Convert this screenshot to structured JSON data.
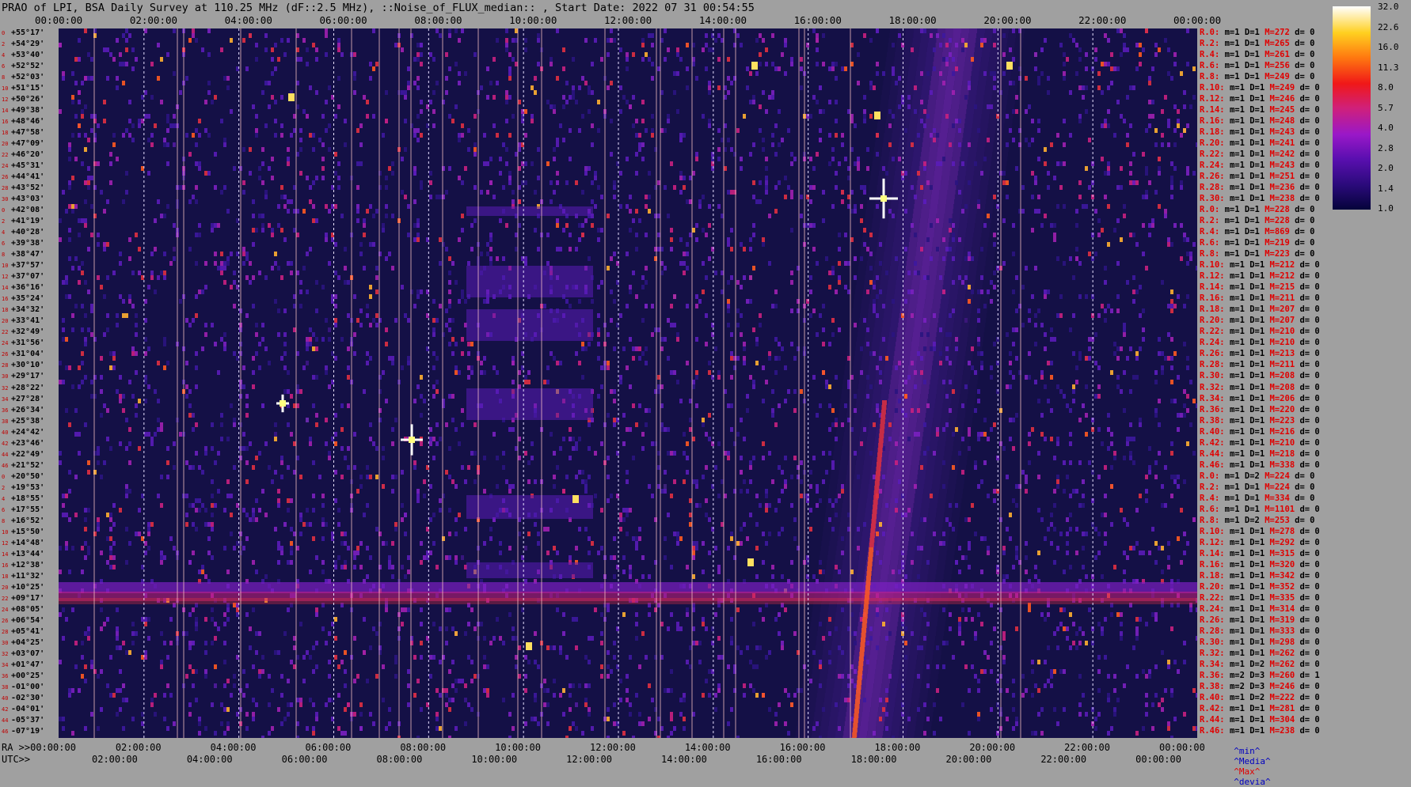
{
  "header": {
    "title": "PRAO of LPI, BSA Daily Survey at 110.25 MHz (dF::2.5 MHz), ::Noise_of_FLUX_median:: , Start Date: 2022 07 31 00:54:55"
  },
  "chart_data": {
    "type": "heatmap",
    "title": "PRAO of LPI, BSA Daily Survey at 110.25 MHz (dF::2.5 MHz), ::Noise_of_FLUX_median:: , Start Date: 2022 07 31 00:54:55",
    "top_axis_ticks": [
      "00:00:00",
      "02:00:00",
      "04:00:00",
      "06:00:00",
      "08:00:00",
      "10:00:00",
      "12:00:00",
      "14:00:00",
      "16:00:00",
      "18:00:00",
      "20:00:00",
      "22:00:00",
      "00:00:00"
    ],
    "bottom_ra_label": "RA >>00:00:00",
    "bottom_ra_ticks": [
      "02:00:00",
      "04:00:00",
      "06:00:00",
      "08:00:00",
      "10:00:00",
      "12:00:00",
      "14:00:00",
      "16:00:00",
      "18:00:00",
      "20:00:00",
      "22:00:00",
      "00:00:00"
    ],
    "bottom_utc_label": "UTC>>",
    "bottom_utc_ticks": [
      "02:00:00",
      "04:00:00",
      "06:00:00",
      "08:00:00",
      "10:00:00",
      "12:00:00",
      "14:00:00",
      "16:00:00",
      "18:00:00",
      "20:00:00",
      "22:00:00",
      "00:00:00"
    ],
    "declinations": [
      "+55°17'",
      "+54°29'",
      "+53°40'",
      "+52°52'",
      "+52°03'",
      "+51°15'",
      "+50°26'",
      "+49°38'",
      "+48°46'",
      "+47°58'",
      "+47°09'",
      "+46°20'",
      "+45°31'",
      "+44°41'",
      "+43°52'",
      "+43°03'",
      "+42°08'",
      "+41°19'",
      "+40°28'",
      "+39°38'",
      "+38°47'",
      "+37°57'",
      "+37°07'",
      "+36°16'",
      "+35°24'",
      "+34°32'",
      "+33°41'",
      "+32°49'",
      "+31°56'",
      "+31°04'",
      "+30°10'",
      "+29°17'",
      "+28°22'",
      "+27°28'",
      "+26°34'",
      "+25°38'",
      "+24°42'",
      "+23°46'",
      "+22°49'",
      "+21°52'",
      "+20°50'",
      "+19°53'",
      "+18°55'",
      "+17°55'",
      "+16°52'",
      "+15°50'",
      "+14°48'",
      "+13°44'",
      "+12°38'",
      "+11°32'",
      "+10°25'",
      "+09°17'",
      "+08°05'",
      "+06°54'",
      "+05°41'",
      "+04°25'",
      "+03°07'",
      "+01°47'",
      "+00°25'",
      "-01°00'",
      "-02°30'",
      "-04°01'",
      "-05°37'",
      "-07°19'"
    ],
    "beam_indices": [
      "0",
      "2",
      "4",
      "6",
      "8",
      "10",
      "12",
      "14",
      "16",
      "18",
      "20",
      "22",
      "24",
      "26",
      "28",
      "30",
      "0",
      "2",
      "4",
      "6",
      "8",
      "10",
      "12",
      "14",
      "16",
      "18",
      "20",
      "22",
      "24",
      "26",
      "28",
      "30",
      "32",
      "34",
      "36",
      "38",
      "40",
      "42",
      "44",
      "46",
      "0",
      "2",
      "4",
      "6",
      "8",
      "10",
      "12",
      "14",
      "16",
      "18",
      "20",
      "22",
      "24",
      "26",
      "28",
      "30",
      "32",
      "34",
      "36",
      "38",
      "40",
      "42",
      "44",
      "46"
    ],
    "colorbar": {
      "ticks": [
        "32.0",
        "22.6",
        "16.0",
        "11.3",
        "8.0",
        "5.7",
        "4.0",
        "2.8",
        "2.0",
        "1.4",
        "1.0"
      ],
      "scale": "log"
    },
    "right_stats": [
      {
        "r": "R.0:",
        "m": "m=1",
        "d": "D=1",
        "M": "M=272",
        "dv": "d= 0"
      },
      {
        "r": "R.2:",
        "m": "m=1",
        "d": "D=1",
        "M": "M=265",
        "dv": "d= 0"
      },
      {
        "r": "R.4:",
        "m": "m=1",
        "d": "D=1",
        "M": "M=261",
        "dv": "d= 0"
      },
      {
        "r": "R.6:",
        "m": "m=1",
        "d": "D=1",
        "M": "M=256",
        "dv": "d= 0"
      },
      {
        "r": "R.8:",
        "m": "m=1",
        "d": "D=1",
        "M": "M=249",
        "dv": "d= 0"
      },
      {
        "r": "R.10:",
        "m": "m=1",
        "d": "D=1",
        "M": "M=249",
        "dv": "d= 0"
      },
      {
        "r": "R.12:",
        "m": "m=1",
        "d": "D=1",
        "M": "M=246",
        "dv": "d= 0"
      },
      {
        "r": "R.14:",
        "m": "m=1",
        "d": "D=1",
        "M": "M=245",
        "dv": "d= 0"
      },
      {
        "r": "R.16:",
        "m": "m=1",
        "d": "D=1",
        "M": "M=248",
        "dv": "d= 0"
      },
      {
        "r": "R.18:",
        "m": "m=1",
        "d": "D=1",
        "M": "M=243",
        "dv": "d= 0"
      },
      {
        "r": "R.20:",
        "m": "m=1",
        "d": "D=1",
        "M": "M=241",
        "dv": "d= 0"
      },
      {
        "r": "R.22:",
        "m": "m=1",
        "d": "D=1",
        "M": "M=242",
        "dv": "d= 0"
      },
      {
        "r": "R.24:",
        "m": "m=1",
        "d": "D=1",
        "M": "M=243",
        "dv": "d= 0"
      },
      {
        "r": "R.26:",
        "m": "m=1",
        "d": "D=1",
        "M": "M=251",
        "dv": "d= 0"
      },
      {
        "r": "R.28:",
        "m": "m=1",
        "d": "D=1",
        "M": "M=236",
        "dv": "d= 0"
      },
      {
        "r": "R.30:",
        "m": "m=1",
        "d": "D=1",
        "M": "M=238",
        "dv": "d= 0"
      },
      {
        "r": "R.0:",
        "m": "m=1",
        "d": "D=1",
        "M": "M=228",
        "dv": "d= 0"
      },
      {
        "r": "R.2:",
        "m": "m=1",
        "d": "D=1",
        "M": "M=228",
        "dv": "d= 0"
      },
      {
        "r": "R.4:",
        "m": "m=1",
        "d": "D=1",
        "M": "M=869",
        "dv": "d= 0"
      },
      {
        "r": "R.6:",
        "m": "m=1",
        "d": "D=1",
        "M": "M=219",
        "dv": "d= 0"
      },
      {
        "r": "R.8:",
        "m": "m=1",
        "d": "D=1",
        "M": "M=223",
        "dv": "d= 0"
      },
      {
        "r": "R.10:",
        "m": "m=1",
        "d": "D=1",
        "M": "M=212",
        "dv": "d= 0"
      },
      {
        "r": "R.12:",
        "m": "m=1",
        "d": "D=1",
        "M": "M=212",
        "dv": "d= 0"
      },
      {
        "r": "R.14:",
        "m": "m=1",
        "d": "D=1",
        "M": "M=215",
        "dv": "d= 0"
      },
      {
        "r": "R.16:",
        "m": "m=1",
        "d": "D=1",
        "M": "M=211",
        "dv": "d= 0"
      },
      {
        "r": "R.18:",
        "m": "m=1",
        "d": "D=1",
        "M": "M=207",
        "dv": "d= 0"
      },
      {
        "r": "R.20:",
        "m": "m=1",
        "d": "D=1",
        "M": "M=207",
        "dv": "d= 0"
      },
      {
        "r": "R.22:",
        "m": "m=1",
        "d": "D=1",
        "M": "M=210",
        "dv": "d= 0"
      },
      {
        "r": "R.24:",
        "m": "m=1",
        "d": "D=1",
        "M": "M=210",
        "dv": "d= 0"
      },
      {
        "r": "R.26:",
        "m": "m=1",
        "d": "D=1",
        "M": "M=213",
        "dv": "d= 0"
      },
      {
        "r": "R.28:",
        "m": "m=1",
        "d": "D=1",
        "M": "M=211",
        "dv": "d= 0"
      },
      {
        "r": "R.30:",
        "m": "m=1",
        "d": "D=1",
        "M": "M=208",
        "dv": "d= 0"
      },
      {
        "r": "R.32:",
        "m": "m=1",
        "d": "D=1",
        "M": "M=208",
        "dv": "d= 0"
      },
      {
        "r": "R.34:",
        "m": "m=1",
        "d": "D=1",
        "M": "M=206",
        "dv": "d= 0"
      },
      {
        "r": "R.36:",
        "m": "m=1",
        "d": "D=1",
        "M": "M=220",
        "dv": "d= 0"
      },
      {
        "r": "R.38:",
        "m": "m=1",
        "d": "D=1",
        "M": "M=223",
        "dv": "d= 0"
      },
      {
        "r": "R.40:",
        "m": "m=1",
        "d": "D=1",
        "M": "M=216",
        "dv": "d= 0"
      },
      {
        "r": "R.42:",
        "m": "m=1",
        "d": "D=1",
        "M": "M=210",
        "dv": "d= 0"
      },
      {
        "r": "R.44:",
        "m": "m=1",
        "d": "D=1",
        "M": "M=218",
        "dv": "d= 0"
      },
      {
        "r": "R.46:",
        "m": "m=1",
        "d": "D=1",
        "M": "M=338",
        "dv": "d= 0"
      },
      {
        "r": "R.0:",
        "m": "m=1",
        "d": "D=2",
        "M": "M=224",
        "dv": "d= 0"
      },
      {
        "r": "R.2:",
        "m": "m=1",
        "d": "D=1",
        "M": "M=224",
        "dv": "d= 0"
      },
      {
        "r": "R.4:",
        "m": "m=1",
        "d": "D=1",
        "M": "M=334",
        "dv": "d= 0"
      },
      {
        "r": "R.6:",
        "m": "m=1",
        "d": "D=1",
        "M": "M=1101",
        "dv": "d= 0"
      },
      {
        "r": "R.8:",
        "m": "m=1",
        "d": "D=2",
        "M": "M=253",
        "dv": "d= 0"
      },
      {
        "r": "R.10:",
        "m": "m=1",
        "d": "D=1",
        "M": "M=278",
        "dv": "d= 0"
      },
      {
        "r": "R.12:",
        "m": "m=1",
        "d": "D=1",
        "M": "M=292",
        "dv": "d= 0"
      },
      {
        "r": "R.14:",
        "m": "m=1",
        "d": "D=1",
        "M": "M=315",
        "dv": "d= 0"
      },
      {
        "r": "R.16:",
        "m": "m=1",
        "d": "D=1",
        "M": "M=320",
        "dv": "d= 0"
      },
      {
        "r": "R.18:",
        "m": "m=1",
        "d": "D=1",
        "M": "M=342",
        "dv": "d= 0"
      },
      {
        "r": "R.20:",
        "m": "m=1",
        "d": "D=1",
        "M": "M=352",
        "dv": "d= 0"
      },
      {
        "r": "R.22:",
        "m": "m=1",
        "d": "D=1",
        "M": "M=335",
        "dv": "d= 0"
      },
      {
        "r": "R.24:",
        "m": "m=1",
        "d": "D=1",
        "M": "M=314",
        "dv": "d= 0"
      },
      {
        "r": "R.26:",
        "m": "m=1",
        "d": "D=1",
        "M": "M=319",
        "dv": "d= 0"
      },
      {
        "r": "R.28:",
        "m": "m=1",
        "d": "D=1",
        "M": "M=333",
        "dv": "d= 0"
      },
      {
        "r": "R.30:",
        "m": "m=1",
        "d": "D=1",
        "M": "M=298",
        "dv": "d= 0"
      },
      {
        "r": "R.32:",
        "m": "m=1",
        "d": "D=1",
        "M": "M=262",
        "dv": "d= 0"
      },
      {
        "r": "R.34:",
        "m": "m=1",
        "d": "D=2",
        "M": "M=262",
        "dv": "d= 0"
      },
      {
        "r": "R.36:",
        "m": "m=2",
        "d": "D=3",
        "M": "M=260",
        "dv": "d= 1"
      },
      {
        "r": "R.38:",
        "m": "m=2",
        "d": "D=3",
        "M": "M=246",
        "dv": "d= 0"
      },
      {
        "r": "R.40:",
        "m": "m=1",
        "d": "D=2",
        "M": "M=222",
        "dv": "d= 0"
      },
      {
        "r": "R.42:",
        "m": "m=1",
        "d": "D=1",
        "M": "M=281",
        "dv": "d= 0"
      },
      {
        "r": "R.44:",
        "m": "m=1",
        "d": "D=1",
        "M": "M=304",
        "dv": "d= 0"
      },
      {
        "r": "R.46:",
        "m": "m=1",
        "d": "D=1",
        "M": "M=238",
        "dv": "d= 0"
      }
    ],
    "legend": {
      "min": "^min^",
      "median": "^Media^",
      "max": "^Max^",
      "devia": "^devia^"
    }
  },
  "colors": {
    "background": "#a0a0a0",
    "plot_bg": "#141046",
    "accent_red": "#e00000",
    "legend_blue": "#0000c0"
  }
}
